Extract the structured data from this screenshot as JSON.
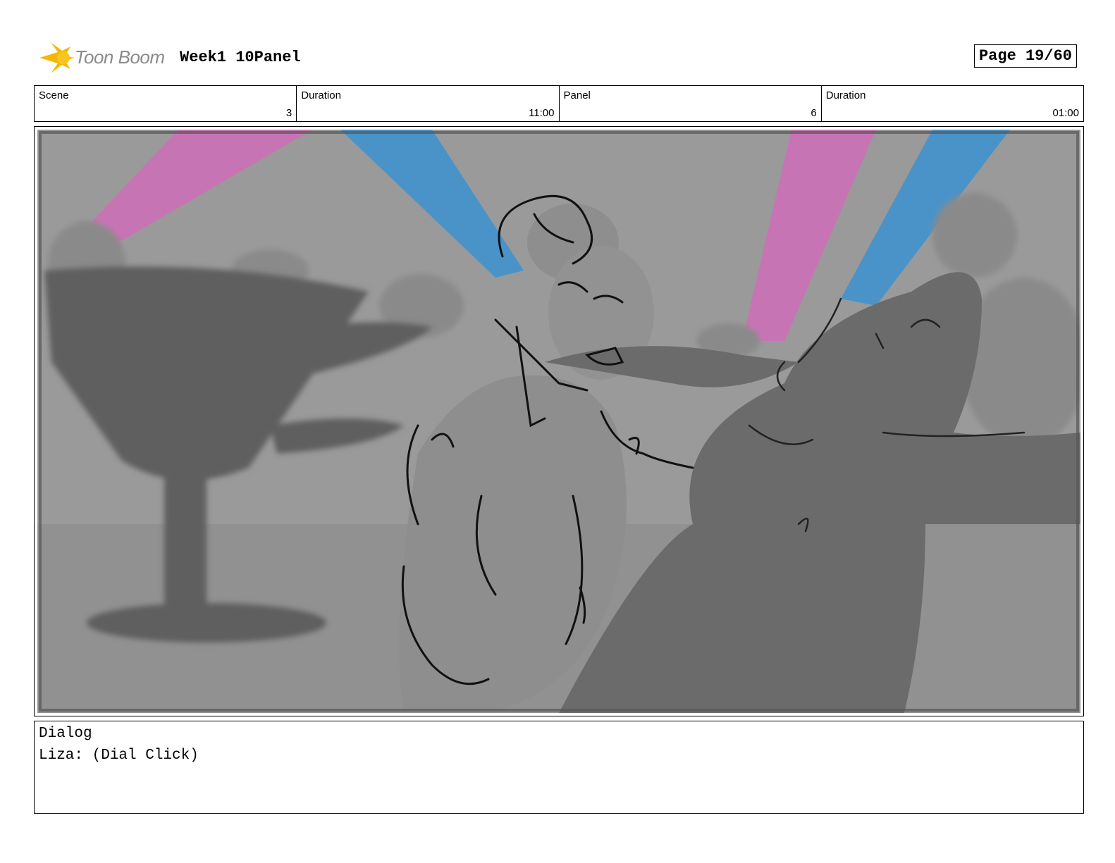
{
  "header": {
    "logo_text": "Toon Boom",
    "project_title": "Week1 10Panel",
    "page_label": "Page 19/60"
  },
  "info": {
    "scene_label": "Scene",
    "scene_value": "3",
    "scene_duration_label": "Duration",
    "scene_duration_value": "11:00",
    "panel_label": "Panel",
    "panel_value": "6",
    "panel_duration_label": "Duration",
    "panel_duration_value": "01:00"
  },
  "dialog": {
    "heading": "Dialog",
    "line": "Liza: (Dial Click)"
  },
  "colors": {
    "logo_yellow": "#f5b800",
    "light_pink": "#c774b4",
    "light_blue": "#4a93c9",
    "background_gray": "#9a9a9a"
  }
}
